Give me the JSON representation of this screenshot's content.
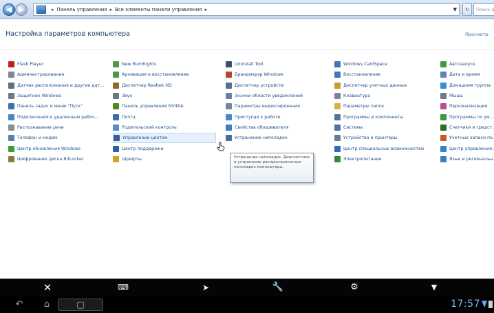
{
  "address": {
    "crumbs": [
      "Панель управления",
      "Все элементы панели управления"
    ],
    "search_placeholder": "Поиск в п"
  },
  "header": {
    "title": "Настройка параметров компьютера",
    "view_by": "Просмотр:"
  },
  "columns": [
    [
      {
        "label": "Flash Player",
        "icon": "flash-icon",
        "color": "#c4201a"
      },
      {
        "label": "Администрирование",
        "icon": "admin-tools-icon",
        "color": "#7b8896"
      },
      {
        "label": "Датчик расположения и другие дат...",
        "icon": "sensor-icon",
        "color": "#5b6f85"
      },
      {
        "label": "Защитник Windows",
        "icon": "defender-icon",
        "color": "#6d7a88"
      },
      {
        "label": "Панель задач и меню \"Пуск\"",
        "icon": "taskbar-icon",
        "color": "#3f6fae"
      },
      {
        "label": "Подключения к удаленным рабоч...",
        "icon": "remote-icon",
        "color": "#4b86c4"
      },
      {
        "label": "Распознавание речи",
        "icon": "microphone-icon",
        "color": "#8a8f96"
      },
      {
        "label": "Телефон и модем",
        "icon": "phone-icon",
        "color": "#5a7fa8"
      },
      {
        "label": "Центр обновления Windows",
        "icon": "update-icon",
        "color": "#3c9a3c"
      },
      {
        "label": "Шифрование диска BitLocker",
        "icon": "bitlocker-icon",
        "color": "#8b7a3a"
      }
    ],
    [
      {
        "label": "New BumRights",
        "icon": "nb-icon",
        "color": "#4e9a3e"
      },
      {
        "label": "Архивация и восстановление",
        "icon": "backup-icon",
        "color": "#4f9a4a"
      },
      {
        "label": "Диспетчер Realtek HD",
        "icon": "realtek-icon",
        "color": "#8a6d2a"
      },
      {
        "label": "Звук",
        "icon": "sound-icon",
        "color": "#6b7785"
      },
      {
        "label": "Панель управления NVIDIA",
        "icon": "nvidia-icon",
        "color": "#4f8a1f"
      },
      {
        "label": "Почта",
        "icon": "mail-icon",
        "color": "#3f6aa8"
      },
      {
        "label": "Родительский контроль",
        "icon": "parental-icon",
        "color": "#5a8cc8"
      },
      {
        "label": "Управление цветом",
        "icon": "color-mgmt-icon",
        "color": "#3b5f8c",
        "hover": true
      },
      {
        "label": "Центр поддержки",
        "icon": "flag-icon",
        "color": "#2f5fa0"
      },
      {
        "label": "Шрифты",
        "icon": "fonts-icon",
        "color": "#d0a32a"
      }
    ],
    [
      {
        "label": "Uninstall Tool",
        "icon": "uninstall-icon",
        "color": "#3c4f66"
      },
      {
        "label": "Брандмауэр Windows",
        "icon": "firewall-icon",
        "color": "#b5462a"
      },
      {
        "label": "Диспетчер устройств",
        "icon": "device-manager-icon",
        "color": "#55708f"
      },
      {
        "label": "Значки области уведомлений",
        "icon": "tray-icon",
        "color": "#6583a6"
      },
      {
        "label": "Параметры индексирования",
        "icon": "indexing-icon",
        "color": "#7a8896"
      },
      {
        "label": "Приступая к работе",
        "icon": "getting-started-icon",
        "color": "#4d86c6"
      },
      {
        "label": "Свойства обозревателя",
        "icon": "ie-icon",
        "color": "#3a7fc8"
      },
      {
        "label": "Устранение неполадок",
        "icon": "troubleshoot-icon",
        "color": "#4a6f9a"
      },
      {
        "label": "",
        "icon": "",
        "color": "#ffffff"
      },
      {
        "label": "",
        "icon": "",
        "color": "#ffffff"
      }
    ],
    [
      {
        "label": "Windows CardSpace",
        "icon": "cardspace-icon",
        "color": "#3f74b8"
      },
      {
        "label": "Восстановление",
        "icon": "recovery-icon",
        "color": "#3d7ab6"
      },
      {
        "label": "Диспетчер учетных данных",
        "icon": "credential-icon",
        "color": "#c89b2a"
      },
      {
        "label": "Клавиатура",
        "icon": "keyboard-icon",
        "color": "#7c8591"
      },
      {
        "label": "Параметры папок",
        "icon": "folder-icon",
        "color": "#d7b04a"
      },
      {
        "label": "Программы и компоненты",
        "icon": "programs-icon",
        "color": "#5b7590"
      },
      {
        "label": "Система",
        "icon": "system-icon",
        "color": "#4c76a6"
      },
      {
        "label": "Устройства и принтеры",
        "icon": "printer-icon",
        "color": "#6b7d91"
      },
      {
        "label": "Центр специальных возможностей",
        "icon": "accessibility-icon",
        "color": "#2f6bb6"
      },
      {
        "label": "Электропитание",
        "icon": "power-icon",
        "color": "#2f8a3a"
      }
    ],
    [
      {
        "label": "Автозапуск",
        "icon": "autoplay-icon",
        "color": "#3f9a48"
      },
      {
        "label": "Дата и время",
        "icon": "clock-icon",
        "color": "#5f86b8"
      },
      {
        "label": "Домашняя группа",
        "icon": "homegroup-icon",
        "color": "#3a8fd0"
      },
      {
        "label": "Мышь",
        "icon": "mouse-icon",
        "color": "#6f7883"
      },
      {
        "label": "Персонализация",
        "icon": "personalization-icon",
        "color": "#b94d9c"
      },
      {
        "label": "Программы по ум...",
        "icon": "default-programs-icon",
        "color": "#3c9a3c"
      },
      {
        "label": "Счетчики и средст...",
        "icon": "performance-icon",
        "color": "#2f6b2f"
      },
      {
        "label": "Учетные записи по...",
        "icon": "accounts-icon",
        "color": "#c85a2a"
      },
      {
        "label": "Центр управления...",
        "icon": "network-center-icon",
        "color": "#3a7fc8"
      },
      {
        "label": "Язык и региональн...",
        "icon": "region-icon",
        "color": "#3a7fc8"
      }
    ]
  ],
  "tooltip": {
    "text": "Устранение неполадок. Диагностика и устранение распространенных неполадок компьютера."
  },
  "android": {
    "appbar_icons": [
      "close-icon",
      "keyboard-icon",
      "cursor-icon",
      "wrench-icon",
      "gear-icon",
      "menu-icon"
    ],
    "nav_icons": [
      "back-icon",
      "home-icon",
      "recent-apps-icon"
    ],
    "clock": "17:57"
  }
}
